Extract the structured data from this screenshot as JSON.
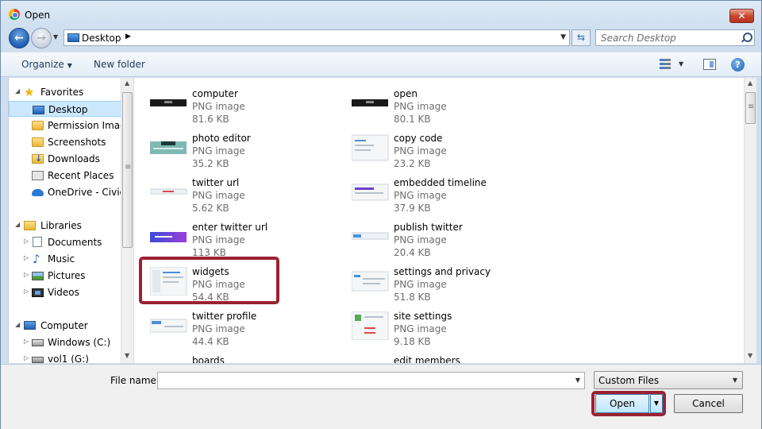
{
  "window": {
    "title": "Open",
    "close_label": "✕"
  },
  "address": {
    "crumb": "Desktop",
    "search_placeholder": "Search Desktop"
  },
  "toolbar": {
    "organize": "Organize",
    "new_folder": "New folder",
    "help": "?"
  },
  "navpane": {
    "favorites": "Favorites",
    "desktop": "Desktop",
    "permission_images": "Permission Images",
    "screenshots": "Screenshots",
    "downloads": "Downloads",
    "recent_places": "Recent Places",
    "onedrive": "OneDrive - CivicPlus",
    "libraries": "Libraries",
    "documents": "Documents",
    "music": "Music",
    "pictures": "Pictures",
    "videos": "Videos",
    "computer": "Computer",
    "windows_c": "Windows (C:)",
    "vol1_g": "vol1 (G:)"
  },
  "files": [
    {
      "name": "computer",
      "type": "PNG image",
      "size": "81.6 KB",
      "thumb": "dark-bar"
    },
    {
      "name": "open",
      "type": "PNG image",
      "size": "80.1 KB",
      "thumb": "dark-bar"
    },
    {
      "name": "photo editor",
      "type": "PNG image",
      "size": "35.2 KB",
      "thumb": "teal-editor"
    },
    {
      "name": "copy code",
      "type": "PNG image",
      "size": "23.2 KB",
      "thumb": "light-page"
    },
    {
      "name": "twitter url",
      "type": "PNG image",
      "size": "5.62 KB",
      "thumb": "url-bar"
    },
    {
      "name": "embedded timeline",
      "type": "PNG image",
      "size": "37.9 KB",
      "thumb": "timeline"
    },
    {
      "name": "enter twitter url",
      "type": "PNG image",
      "size": "113 KB",
      "thumb": "purple-banner"
    },
    {
      "name": "publish twitter",
      "type": "PNG image",
      "size": "20.4 KB",
      "thumb": "blue-strip"
    },
    {
      "name": "widgets",
      "type": "PNG image",
      "size": "54.4 KB",
      "thumb": "widgets-page"
    },
    {
      "name": "settings and privacy",
      "type": "PNG image",
      "size": "51.8 KB",
      "thumb": "settings-page"
    },
    {
      "name": "twitter profile",
      "type": "PNG image",
      "size": "44.4 KB",
      "thumb": "profile-page"
    },
    {
      "name": "site settings",
      "type": "PNG image",
      "size": "9.18 KB",
      "thumb": "site-settings"
    },
    {
      "name": "boards",
      "type": "",
      "size": "",
      "thumb": "boards"
    },
    {
      "name": "edit members",
      "type": "",
      "size": "",
      "thumb": "none"
    }
  ],
  "bottom": {
    "file_name_label": "File name:",
    "file_name_value": "",
    "file_type": "Custom Files",
    "open": "Open",
    "cancel": "Cancel"
  }
}
